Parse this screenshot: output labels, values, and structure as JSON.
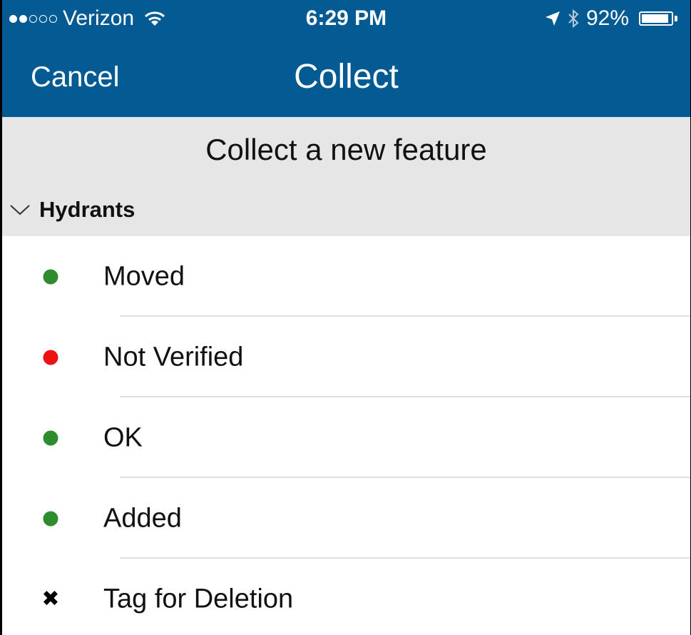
{
  "status_bar": {
    "signal_full": 2,
    "signal_total": 5,
    "carrier": "Verizon",
    "time": "6:29 PM",
    "battery": "92%",
    "battery_level": 0.92
  },
  "nav": {
    "cancel_label": "Cancel",
    "title": "Collect"
  },
  "section": {
    "title": "Collect a new feature",
    "group_label": "Hydrants"
  },
  "items": [
    {
      "label": "Moved",
      "symbol": "circle",
      "color": "#2e8b2e"
    },
    {
      "label": "Not Verified",
      "symbol": "circle",
      "color": "#ee1111"
    },
    {
      "label": "OK",
      "symbol": "circle",
      "color": "#2e8b2e"
    },
    {
      "label": "Added",
      "symbol": "circle",
      "color": "#2e8b2e"
    },
    {
      "label": "Tag for Deletion",
      "symbol": "x-mark",
      "color": "#000000"
    }
  ],
  "colors": {
    "nav_background": "#045a93",
    "section_background": "#e6e6e6"
  }
}
